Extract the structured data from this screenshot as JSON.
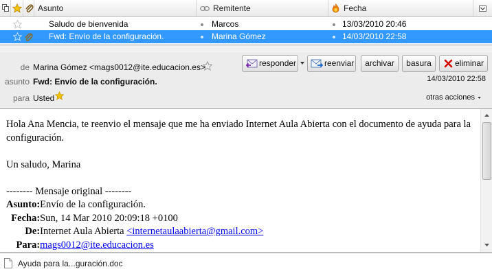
{
  "columns": {
    "subject": "Asunto",
    "sender": "Remitente",
    "date": "Fecha"
  },
  "messages": [
    {
      "subject": "Saludo de bienvenida",
      "sender": "Marcos",
      "date": "13/03/2010 20:46",
      "starred": false,
      "attachment": false,
      "selected": false
    },
    {
      "subject": "Fwd: Envío de la configuración.",
      "sender": "Marina Gómez",
      "date": "14/03/2010 22:58",
      "starred": false,
      "attachment": true,
      "selected": true
    }
  ],
  "header": {
    "from_label": "de",
    "from_value": "Marina Gómez <mags0012@ite.educacion.es>",
    "subject_label": "asunto",
    "subject_value": "Fwd: Envío de la configuración.",
    "to_label": "para",
    "to_value": "Usted",
    "date": "14/03/2010 22:58",
    "more_actions": "otras acciones"
  },
  "toolbar": {
    "reply": "responder",
    "forward": "reenviar",
    "archive": "archivar",
    "junk": "basura",
    "delete": "eliminar"
  },
  "body": {
    "greeting": "Hola Ana Mencia, te reenvio el mensaje que me ha enviado Internet Aula Abierta con el documento de ayuda para la configuración.",
    "signoff": "Un saludo, Marina",
    "orig_header": "-------- Mensaje original --------",
    "k_subject": "Asunto:",
    "v_subject": "Envío de la configuración.",
    "k_date": "Fecha:",
    "v_date": "Sun, 14 Mar 2010 20:09:18 +0100",
    "k_from": "De:",
    "v_from": "Internet Aula Abierta ",
    "v_from_link": "<internetaulaabierta@gmail.com>",
    "k_to": "Para:",
    "v_to_link": "mags0012@ite.educacion.es"
  },
  "attachment": {
    "name": "Ayuda para la...guración.doc"
  },
  "colors": {
    "selection": "#3399ff",
    "accent_star": "#f5c400"
  }
}
